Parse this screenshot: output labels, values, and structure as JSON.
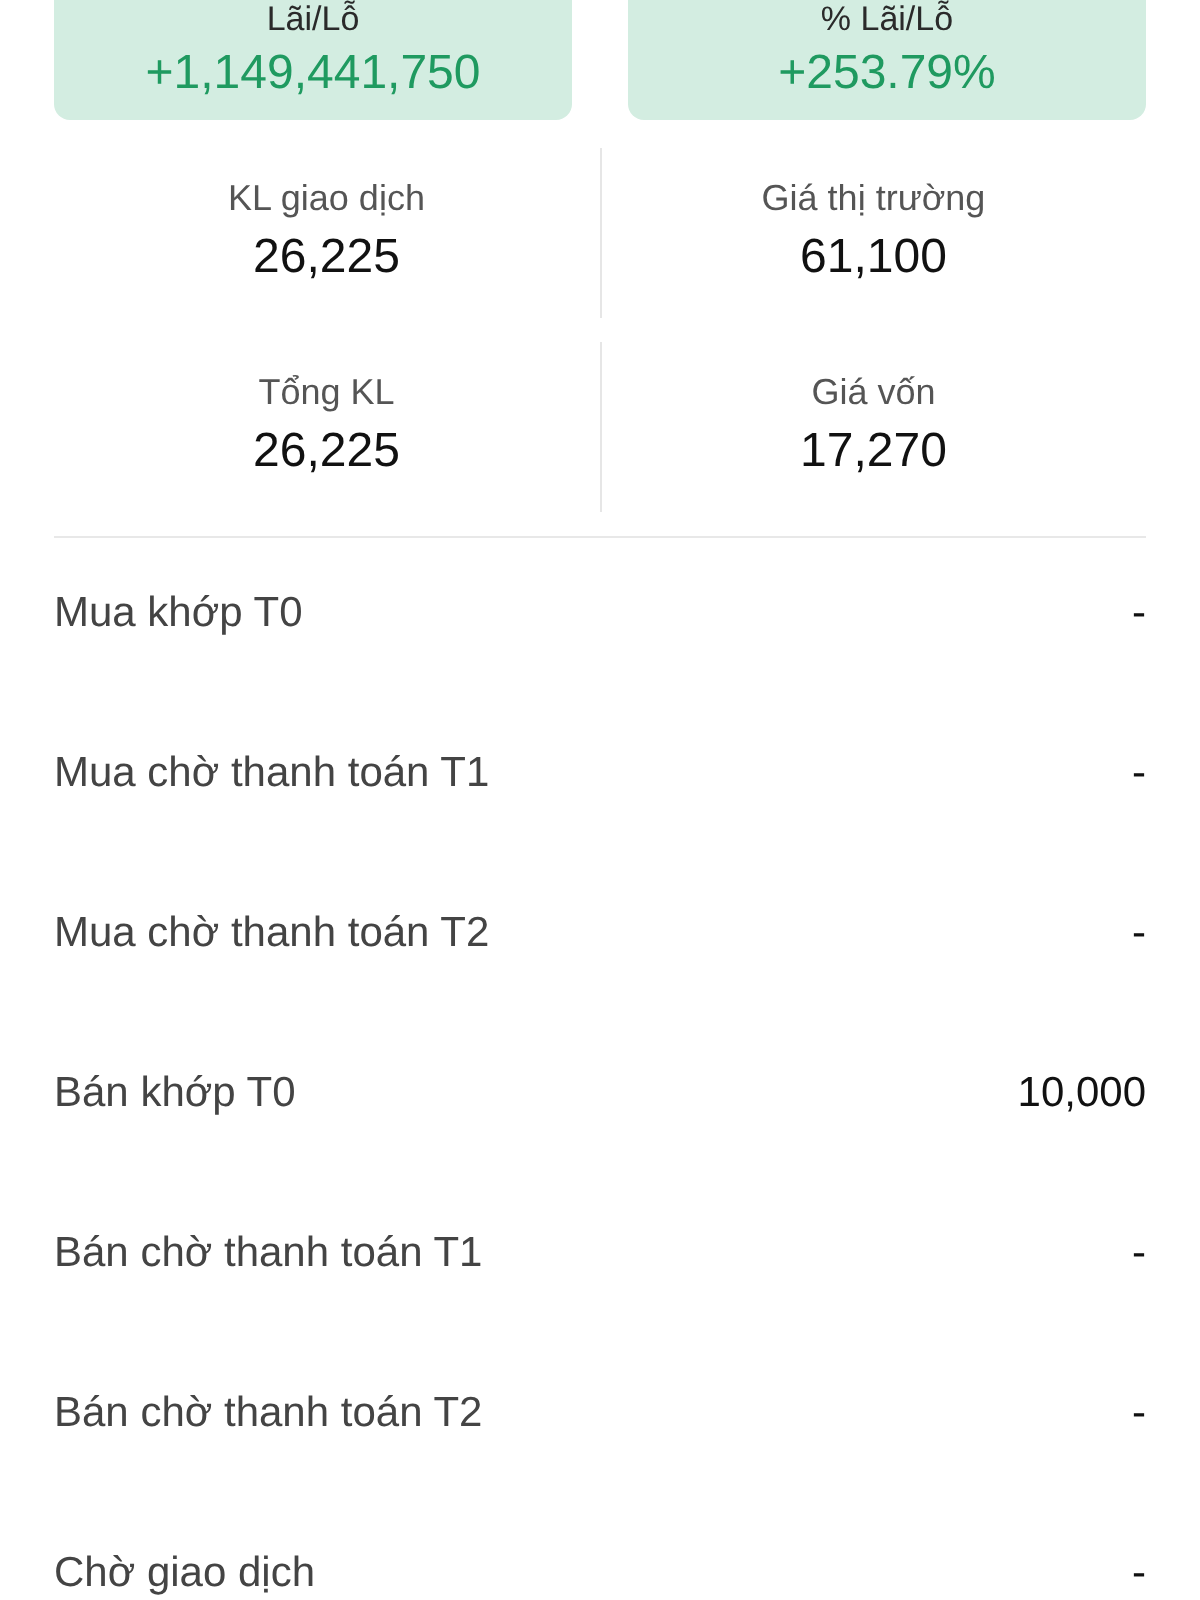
{
  "summary_cards": [
    {
      "label": "Lãi/Lỗ",
      "value": "+1,149,441,750"
    },
    {
      "label": "% Lãi/Lỗ",
      "value": "+253.79%"
    }
  ],
  "stats": [
    {
      "label": "KL giao dịch",
      "value": "26,225"
    },
    {
      "label": "Giá thị trường",
      "value": "61,100"
    },
    {
      "label": "Tổng KL",
      "value": "26,225"
    },
    {
      "label": "Giá vốn",
      "value": "17,270"
    }
  ],
  "details": [
    {
      "label": "Mua khớp T0",
      "value": "-"
    },
    {
      "label": "Mua chờ thanh toán T1",
      "value": "-"
    },
    {
      "label": "Mua chờ thanh toán T2",
      "value": "-"
    },
    {
      "label": "Bán khớp T0",
      "value": "10,000"
    },
    {
      "label": "Bán chờ thanh toán T1",
      "value": "-"
    },
    {
      "label": "Bán chờ thanh toán T2",
      "value": "-"
    },
    {
      "label": "Chờ giao dịch",
      "value": "-"
    }
  ]
}
